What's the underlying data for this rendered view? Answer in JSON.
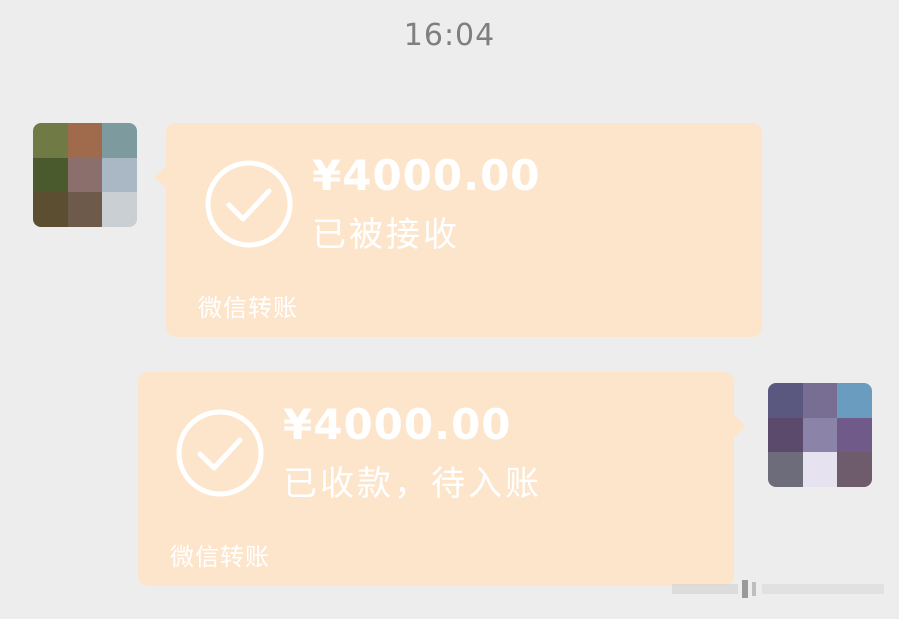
{
  "chat": {
    "timestamp": "16:04"
  },
  "messages": [
    {
      "sender": "other",
      "amount": "¥4000.00",
      "status": "已被接收",
      "label": "微信转账"
    },
    {
      "sender": "self",
      "amount": "¥4000.00",
      "status": "已收款，待入账",
      "label": "微信转账"
    }
  ],
  "colors": {
    "background": "#ededed",
    "bubble": "#fde5cc",
    "text": "#ffffff",
    "timestamp": "#7f7f7f"
  },
  "icons": {
    "check": "check-circle-icon"
  }
}
